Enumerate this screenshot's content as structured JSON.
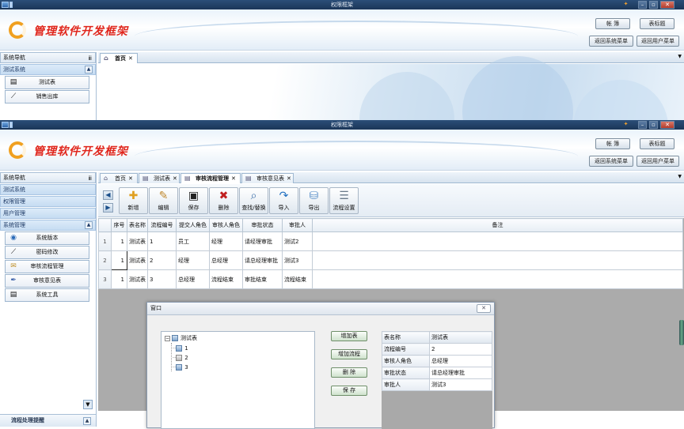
{
  "window": {
    "title": "权限框架"
  },
  "header": {
    "logo_text": "管理软件开发框架",
    "buttons": [
      "帐  簿",
      "表标题",
      "返回系统菜单",
      "返回用户菜单"
    ]
  },
  "sidebar": {
    "title": "系统导航",
    "pin": "ⅲ",
    "footer": "流程处理提醒"
  },
  "win1": {
    "groups": [
      "测试系统"
    ],
    "items": [
      {
        "label": "测试表",
        "icon": "table-icon"
      },
      {
        "label": "销售出库",
        "icon": "chart-icon"
      }
    ],
    "tabs": [
      {
        "label": "首页",
        "icon": "home-icon"
      }
    ]
  },
  "win2": {
    "groups": [
      "测试系统",
      "权限管理",
      "用户管理",
      "系统管理"
    ],
    "items": [
      {
        "label": "系统版本",
        "icon": "globe-icon"
      },
      {
        "label": "密码修改",
        "icon": "chart-icon"
      },
      {
        "label": "审核流程管理",
        "icon": "notes-icon"
      },
      {
        "label": "审核意见表",
        "icon": "pen-icon"
      },
      {
        "label": "系统工具",
        "icon": "table-icon"
      }
    ],
    "tabs": [
      {
        "label": "首页",
        "icon": "home-icon"
      },
      {
        "label": "测试表",
        "icon": "table-icon"
      },
      {
        "label": "审核流程管理",
        "icon": "table-icon"
      },
      {
        "label": "审核意见表",
        "icon": "table-icon"
      }
    ],
    "toolbar": [
      {
        "label": "新增",
        "icon": "add-icon",
        "glyph": "✚",
        "color": "#e0a020"
      },
      {
        "label": "编辑",
        "icon": "edit-icon",
        "glyph": "✎",
        "color": "#c08a30"
      },
      {
        "label": "保存",
        "icon": "save-icon",
        "glyph": "▣",
        "color": "#222222"
      },
      {
        "label": "删除",
        "icon": "delete-icon",
        "glyph": "✖",
        "color": "#c02020"
      },
      {
        "label": "查找/替换",
        "icon": "find-icon",
        "glyph": "⌕",
        "color": "#3b6ea8"
      },
      {
        "label": "导入",
        "icon": "import-icon",
        "glyph": "↷",
        "color": "#1f6fc0"
      },
      {
        "label": "导出",
        "icon": "export-icon",
        "glyph": "⛁",
        "color": "#5a8fc8"
      },
      {
        "label": "流程设置",
        "icon": "settings-icon",
        "glyph": "☰",
        "color": "#6a7a8a"
      }
    ],
    "grid": {
      "columns": [
        "序号",
        "表名称",
        "流程编号",
        "提交人角色",
        "审核人角色",
        "审批状态",
        "审批人",
        "备注"
      ],
      "rows": [
        [
          "1",
          "1",
          "测试表",
          "1",
          "员工",
          "经理",
          "请经理审批",
          "测试2",
          ""
        ],
        [
          "2",
          "1",
          "测试表",
          "2",
          "经理",
          "总经理",
          "请总经理审批",
          "测试3",
          ""
        ],
        [
          "3",
          "1",
          "测试表",
          "3",
          "总经理",
          "流程结束",
          "审批结束",
          "流程结束",
          ""
        ]
      ]
    }
  },
  "dialog": {
    "title": "窗口",
    "close": "✕",
    "tree": {
      "root": "测试表",
      "children": [
        "1",
        "2",
        "3"
      ]
    },
    "buttons": [
      "增加表",
      "增加流程",
      "删  除",
      "保  存"
    ],
    "properties": [
      [
        "表名称",
        "测试表"
      ],
      [
        "流程编号",
        "2"
      ],
      [
        "审核人角色",
        "总经理"
      ],
      [
        "审批状态",
        "请总经理审批"
      ],
      [
        "审批人",
        "测试3"
      ]
    ]
  },
  "colors": {
    "brand_red": "#e0261c",
    "logo_orange": "#f0a020",
    "titlebar": "#1b3658"
  }
}
